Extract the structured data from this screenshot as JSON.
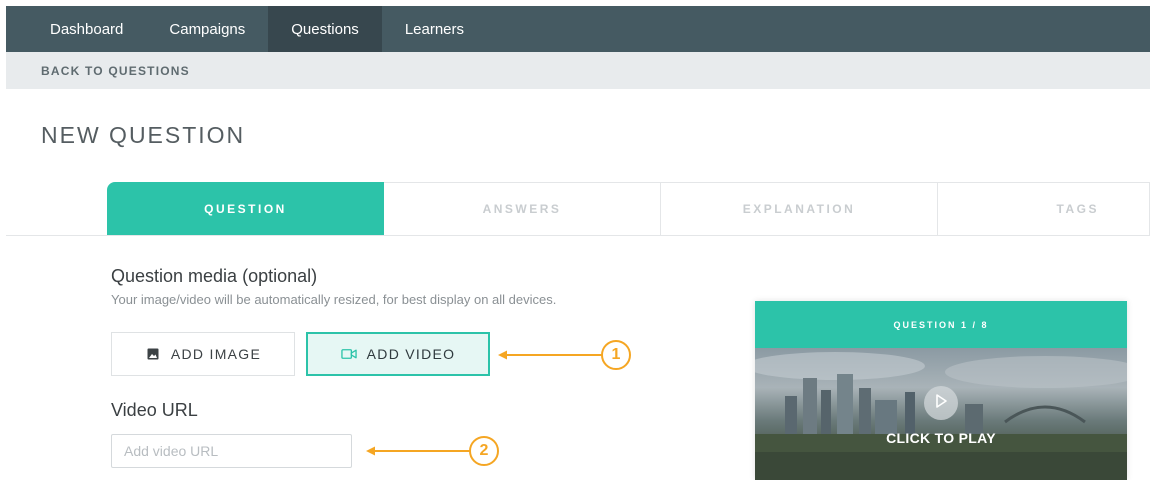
{
  "nav": {
    "items": [
      {
        "label": "Dashboard",
        "active": false
      },
      {
        "label": "Campaigns",
        "active": false
      },
      {
        "label": "Questions",
        "active": true
      },
      {
        "label": "Learners",
        "active": false
      }
    ]
  },
  "back_link": "BACK TO QUESTIONS",
  "page_title": "NEW QUESTION",
  "tabs": [
    {
      "label": "QUESTION",
      "active": true
    },
    {
      "label": "ANSWERS",
      "active": false
    },
    {
      "label": "EXPLANATION",
      "active": false
    },
    {
      "label": "TAGS",
      "active": false
    }
  ],
  "media": {
    "title": "Question media (optional)",
    "subtitle": "Your image/video will be automatically resized, for best display on all devices.",
    "add_image_label": "ADD IMAGE",
    "add_video_label": "ADD VIDEO",
    "add_image_icon": "image-icon",
    "add_video_icon": "video-camera-icon"
  },
  "video_url": {
    "label": "Video URL",
    "placeholder": "Add video URL",
    "value": ""
  },
  "callouts": [
    "1",
    "2"
  ],
  "preview": {
    "header": "QUESTION 1 / 8",
    "play_label": "CLICK TO PLAY",
    "play_icon": "play-icon"
  },
  "colors": {
    "nav_bg": "#455a62",
    "accent": "#2cc3a9",
    "callout": "#f5a623"
  }
}
